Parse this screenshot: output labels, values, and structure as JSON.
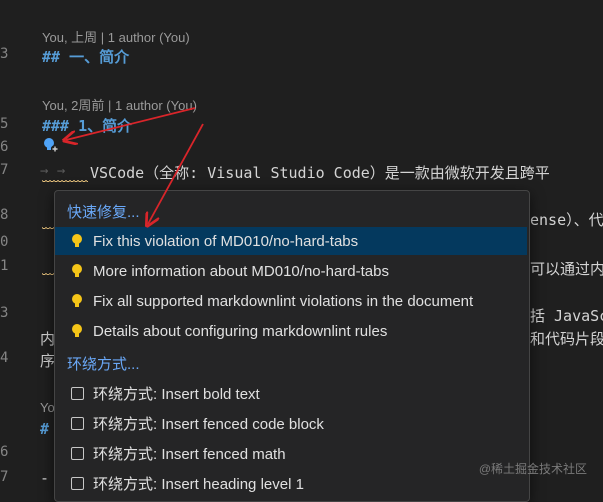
{
  "gutter": {
    "line_numbers": [
      "3",
      "5",
      "6",
      "7",
      "8",
      "0",
      "1",
      "3",
      "4",
      "6",
      "7"
    ]
  },
  "editor": {
    "codelens_1": "You, 上周 | 1 author (You)",
    "heading_1": "## 一、简介",
    "codelens_2": "You, 2周前 | 1 author (You)",
    "heading_2": "### 1、简介",
    "line7_text": "VSCode（全称: Visual Studio Code）是一款由微软开发且跨平",
    "right_fragment_1": "ense）、代",
    "right_fragment_2": "可以通过内",
    "right_fragment_3": "括 JavaSc",
    "right_fragment_4": "和代码片段",
    "left_fragment_1": "内",
    "left_fragment_2": "序",
    "left_fragment_3": "Yo",
    "left_fragment_4": "#",
    "left_fragment_5": "-",
    "tab_arrows": "→ →"
  },
  "quick_fix_menu": {
    "header": "快速修复...",
    "items": [
      {
        "label": "Fix this violation of MD010/no-hard-tabs",
        "icon": "lightbulb-icon"
      },
      {
        "label": "More information about MD010/no-hard-tabs",
        "icon": "lightbulb-icon"
      },
      {
        "label": "Fix all supported markdownlint violations in the document",
        "icon": "lightbulb-icon"
      },
      {
        "label": "Details about configuring markdownlint rules",
        "icon": "lightbulb-icon"
      }
    ],
    "surround_header": "环绕方式...",
    "surround_items": [
      {
        "label": "环绕方式: Insert bold text",
        "icon": "checkbox-icon"
      },
      {
        "label": "环绕方式: Insert fenced code block",
        "icon": "checkbox-icon"
      },
      {
        "label": "环绕方式: Insert fenced math",
        "icon": "checkbox-icon"
      },
      {
        "label": "环绕方式: Insert heading level 1",
        "icon": "checkbox-icon"
      }
    ]
  },
  "colors": {
    "selected_bg": "#04395e",
    "lightbulb": "#f5c518",
    "arrow": "#d9252a",
    "header_blue": "#6aa8f7"
  },
  "watermark": "@稀土掘金技术社区"
}
